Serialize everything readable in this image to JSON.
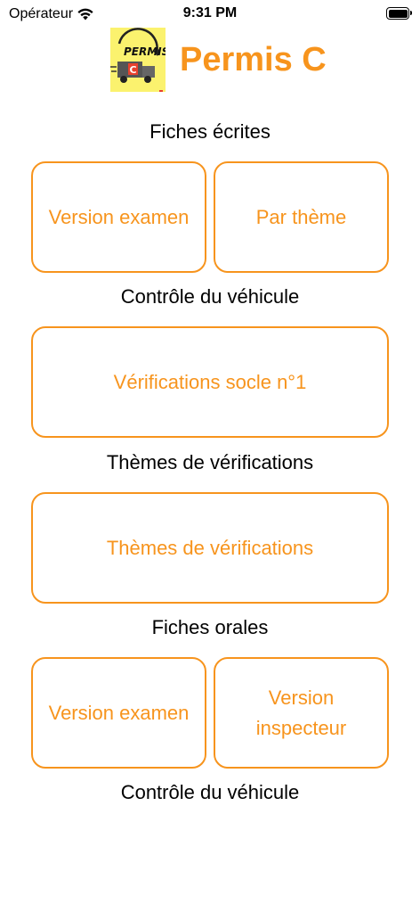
{
  "status_bar": {
    "carrier": "Opérateur",
    "time": "9:31 PM"
  },
  "header": {
    "title": "Permis C",
    "logo_text": "PERMIS",
    "logo_letter": "C"
  },
  "colors": {
    "accent": "#f7941d",
    "logo_background": "#fbf26e"
  },
  "sections": {
    "fiches_ecrites": {
      "title": "Fiches écrites",
      "btn_version_examen": "Version examen",
      "btn_par_theme": "Par thème"
    },
    "controle_vehicule": {
      "title": "Contrôle du véhicule",
      "btn_verifications_socle": "Vérifications socle n°1"
    },
    "themes_verifications": {
      "title": "Thèmes de vérifications",
      "btn_themes": "Thèmes de vérifications"
    },
    "fiches_orales": {
      "title": "Fiches orales",
      "btn_version_examen": "Version examen",
      "btn_version_inspecteur": "Version inspecteur"
    },
    "controle_vehicule_2": {
      "title": "Contrôle du véhicule"
    }
  }
}
